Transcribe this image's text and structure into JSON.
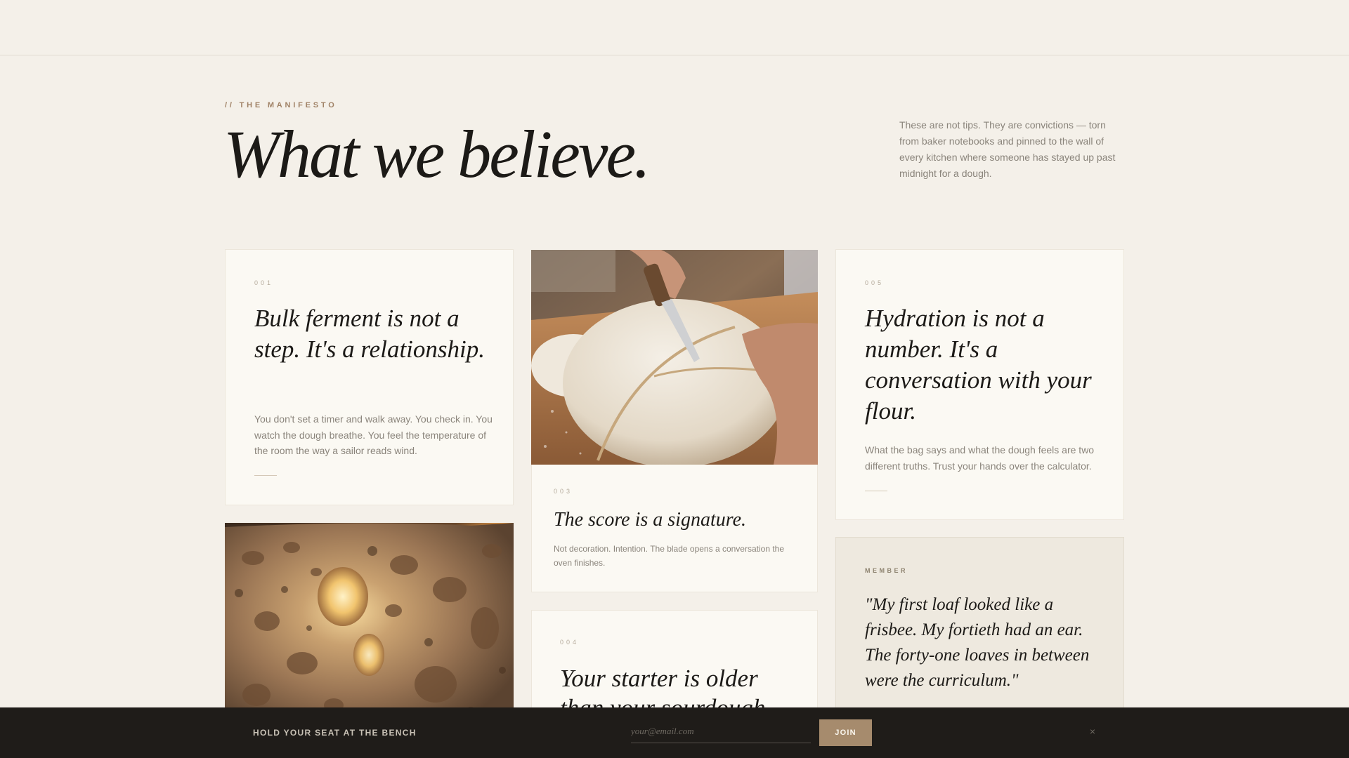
{
  "manifesto": {
    "eyebrow": "// THE MANIFESTO",
    "title": "What we believe.",
    "intro": "These are not tips. They are convictions — torn from baker notebooks and pinned to the wall of every kitchen where someone has stayed up past midnight for a dough."
  },
  "cards": [
    {
      "number": "001",
      "title": "Bulk ferment is not a step. It's a relationship.",
      "body": "You don't set a timer and walk away. You check in. You watch the dough breathe. You feel the temperature of the room the way a sailor reads wind."
    },
    {
      "number": "003",
      "title": "The score is a signature.",
      "body": "Not decoration. Intention. The blade opens a conversation the oven finishes."
    },
    {
      "number": "004",
      "title": "Your starter is older than your sourdough."
    },
    {
      "number": "005",
      "title": "Hydration is not a number. It's a conversation with your flour.",
      "body": "What the bag says and what the dough feels are two different truths. Trust your hands over the calculator."
    }
  ],
  "testimonial": {
    "label": "MEMBER",
    "quote": "\"My first loaf looked like a frisbee. My fortieth had an ear. The forty-one loaves in between were the curriculum.\""
  },
  "signup": {
    "label": "HOLD YOUR SEAT AT THE BENCH",
    "email_placeholder": "your@email.com",
    "email_value": "",
    "join_label": "JOIN",
    "close_icon": "×"
  },
  "colors": {
    "background": "#f4f0e9",
    "card": "#fbf9f3",
    "accent": "#a68b6d",
    "bar": "#1f1c19"
  }
}
